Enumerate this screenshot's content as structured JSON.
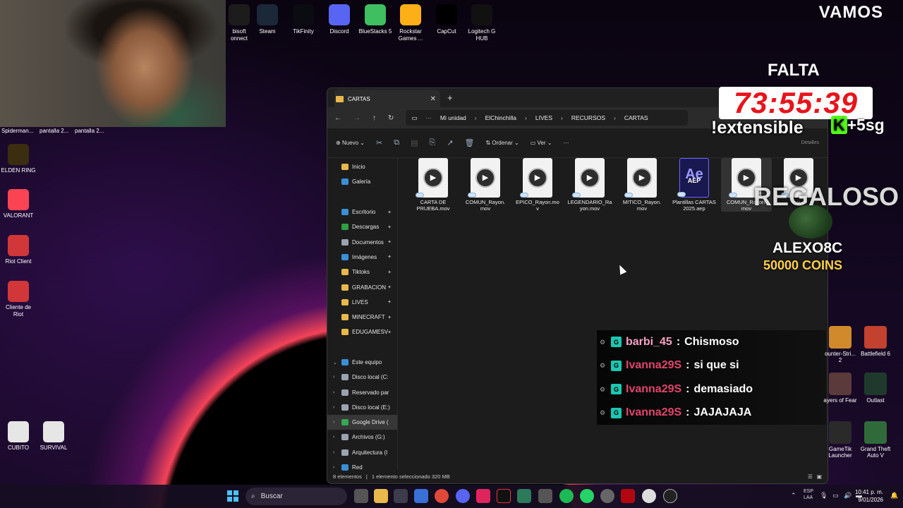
{
  "top_icons": [
    {
      "label": "bisoft\nonnect",
      "icon": "ubisoft-icon",
      "color": "#1c1c1c"
    },
    {
      "label": "Steam",
      "icon": "steam-icon",
      "color": "#1b2838"
    },
    {
      "label": "TikFinity",
      "icon": "tikfinity-icon",
      "color": "#0b0b12"
    },
    {
      "label": "Discord",
      "icon": "discord-icon",
      "color": "#5865f2"
    },
    {
      "label": "BlueStacks 5",
      "icon": "bluestacks-icon",
      "color": "#3fbf5f"
    },
    {
      "label": "Rockstar\nGames ...",
      "icon": "rockstar-icon",
      "color": "#fcaf17"
    },
    {
      "label": "CapCut",
      "icon": "capcut-icon",
      "color": "#000000"
    },
    {
      "label": "Logitech G\nHUB",
      "icon": "logitech-icon",
      "color": "#111111"
    }
  ],
  "webcam_labels": [
    "Spiderman...",
    "pantalla 2...",
    "pantalla 2..."
  ],
  "desktop_icons_left": [
    {
      "label": "ELDEN RING",
      "icon": "elden-ring-icon",
      "color": "#3a2d10"
    },
    {
      "label": "VALORANT",
      "icon": "valorant-icon",
      "color": "#fa4454"
    },
    {
      "label": "Riot Client",
      "icon": "riot-client-icon",
      "color": "#d13639"
    },
    {
      "label": "Cliente de\nRiot",
      "icon": "riot-client-icon",
      "color": "#d13639"
    },
    {
      "label": "CUBITO",
      "icon": "file-icon",
      "color": "#e6e6e6"
    },
    {
      "label": "SURVIVAL",
      "icon": "file-icon",
      "color": "#e6e6e6"
    }
  ],
  "explorer": {
    "tab_title": "CARTAS",
    "breadcrumbs": [
      "Mi unidad",
      "ElChinchilla",
      "LIVES",
      "RECURSOS",
      "CARTAS"
    ],
    "breadcrumb_overflow": "···",
    "toolbar": {
      "new": "Nuevo",
      "sort": "Ordenar",
      "view": "Ver",
      "more": "···"
    },
    "details_label": "Detalles",
    "sidebar": [
      {
        "label": "Inicio",
        "icon": "home-icon",
        "color": "#e8b84a",
        "pin": false
      },
      {
        "label": "Galería",
        "icon": "gallery-icon",
        "color": "#3a8fd6",
        "pin": false
      },
      {
        "label": "",
        "icon": "",
        "color": "",
        "pin": false
      },
      {
        "label": "Escritorio",
        "icon": "desktop-icon",
        "color": "#3a8fd6",
        "pin": true
      },
      {
        "label": "Descargas",
        "icon": "download-icon",
        "color": "#2ea043",
        "pin": true
      },
      {
        "label": "Documentos",
        "icon": "documents-icon",
        "color": "#9aa4b0",
        "pin": true
      },
      {
        "label": "Imágenes",
        "icon": "pictures-icon",
        "color": "#3a8fd6",
        "pin": true
      },
      {
        "label": "Tiktoks",
        "icon": "folder-icon",
        "color": "#e8b84a",
        "pin": true
      },
      {
        "label": "GRABACION",
        "icon": "folder-icon",
        "color": "#e8b84a",
        "pin": true
      },
      {
        "label": "LIVES",
        "icon": "folder-icon",
        "color": "#e8b84a",
        "pin": true
      },
      {
        "label": "MINECRAFT",
        "icon": "folder-icon",
        "color": "#e8b84a",
        "pin": true
      },
      {
        "label": "EDUGAMESV",
        "icon": "folder-icon",
        "color": "#e8b84a",
        "pin": true
      },
      {
        "label": "",
        "icon": "",
        "color": "",
        "pin": false
      },
      {
        "label": "Este equipo",
        "icon": "pc-icon",
        "color": "#3a8fd6",
        "pin": false
      },
      {
        "label": "Disco local (C:",
        "icon": "drive-icon",
        "color": "#9aa4b0",
        "pin": false
      },
      {
        "label": "Reservado par",
        "icon": "drive-icon",
        "color": "#9aa4b0",
        "pin": false
      },
      {
        "label": "Disco local (E:)",
        "icon": "drive-icon",
        "color": "#9aa4b0",
        "pin": false
      },
      {
        "label": "Google Drive (",
        "icon": "google-drive-icon",
        "color": "#34a853",
        "pin": false
      },
      {
        "label": "Archivos (G:)",
        "icon": "drive-icon",
        "color": "#9aa4b0",
        "pin": false
      },
      {
        "label": "Arquitectura (I",
        "icon": "drive-icon",
        "color": "#9aa4b0",
        "pin": false
      },
      {
        "label": "Red",
        "icon": "network-icon",
        "color": "#3a8fd6",
        "pin": false
      }
    ],
    "files": [
      {
        "name": "CARTA DE\nPRUEBA.mov",
        "type": "video"
      },
      {
        "name": "COMUN_Rayon.\nmov",
        "type": "video"
      },
      {
        "name": "EPICO_Rayon.mo\nv",
        "type": "video"
      },
      {
        "name": "LEGENDARIO_Ra\nyon.mov",
        "type": "video"
      },
      {
        "name": "MITICO_Rayon.\nmov",
        "type": "video"
      },
      {
        "name": "Plantillas CARTAS\n2025.aep",
        "type": "aep"
      },
      {
        "name": "COMUN_Rayon.\nmov",
        "type": "video"
      },
      {
        "name": "v",
        "type": "video"
      }
    ],
    "status": {
      "count": "8 elementos",
      "selection": "1 elemento seleccionado  320 MB"
    }
  },
  "overlay": {
    "vamos": "VAMOS",
    "falta": "FALTA",
    "timer": "73:55:39",
    "extensible": "!extensible",
    "plus": "+5sg",
    "k_logo": "K",
    "regaloso": "REGALOSO",
    "donor": "ALEXO8C",
    "coins": "50000 COINS"
  },
  "chat": [
    {
      "user": "barbi_45",
      "message": "Chismoso",
      "style": "user1"
    },
    {
      "user": "Ivanna29S",
      "message": "si que si",
      "style": "user2"
    },
    {
      "user": "Ivanna29S",
      "message": "demasiado",
      "style": "user2"
    },
    {
      "user": "Ivanna29S",
      "message": "JAJAJAJA",
      "style": "user2"
    }
  ],
  "desktop_icons_right": [
    {
      "label": "ounter-Stri...\n2",
      "icon": "counter-strike-icon",
      "color": "#d08a2c"
    },
    {
      "label": "Battlefield 6",
      "icon": "battlefield-icon",
      "color": "#c2412f"
    },
    {
      "label": "ayers of Fear",
      "icon": "layers-of-fear-icon",
      "color": "#5a3a3a"
    },
    {
      "label": "Outlast",
      "icon": "outlast-icon",
      "color": "#1f3a2c"
    },
    {
      "label": "GameTik\nLauncher",
      "icon": "gametik-icon",
      "color": "#2a2a2a"
    },
    {
      "label": "Grand Theft\nAuto V",
      "icon": "gta-icon",
      "color": "#2f6b3a"
    }
  ],
  "taskbar": {
    "search_placeholder": "Buscar",
    "lang": "ESP\nLAA",
    "time": "10:41 p. m.",
    "date": "9/01/2026"
  }
}
